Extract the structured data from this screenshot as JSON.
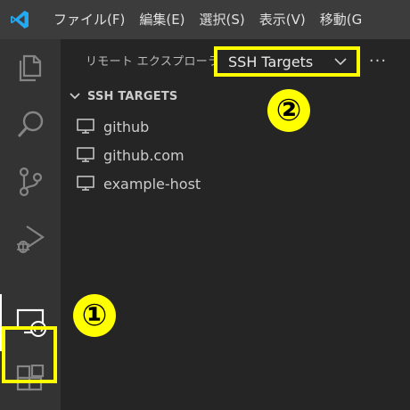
{
  "menubar": {
    "items": [
      "ファイル(F)",
      "編集(E)",
      "選択(S)",
      "表示(V)",
      "移動(G"
    ]
  },
  "activity_bar": {
    "icons": [
      "files-icon",
      "search-icon",
      "source-control-icon",
      "run-debug-icon",
      "remote-explorer-icon",
      "extensions-icon"
    ],
    "active": "remote-explorer-icon"
  },
  "sidebar": {
    "title": "リモート エクスプローラー",
    "target_select": {
      "value": "SSH Targets"
    },
    "more_label": "···",
    "section": {
      "title": "SSH TARGETS",
      "hosts": [
        "github",
        "github.com",
        "example-host"
      ]
    }
  },
  "annotations": {
    "badge_1": "①",
    "badge_2": "②",
    "highlight_color": "#ffff00"
  },
  "colors": {
    "menubar_bg": "#3c3c3c",
    "activitybar_bg": "#333333",
    "sidebar_bg": "#252526",
    "vscode_blue": "#23a9f2"
  }
}
